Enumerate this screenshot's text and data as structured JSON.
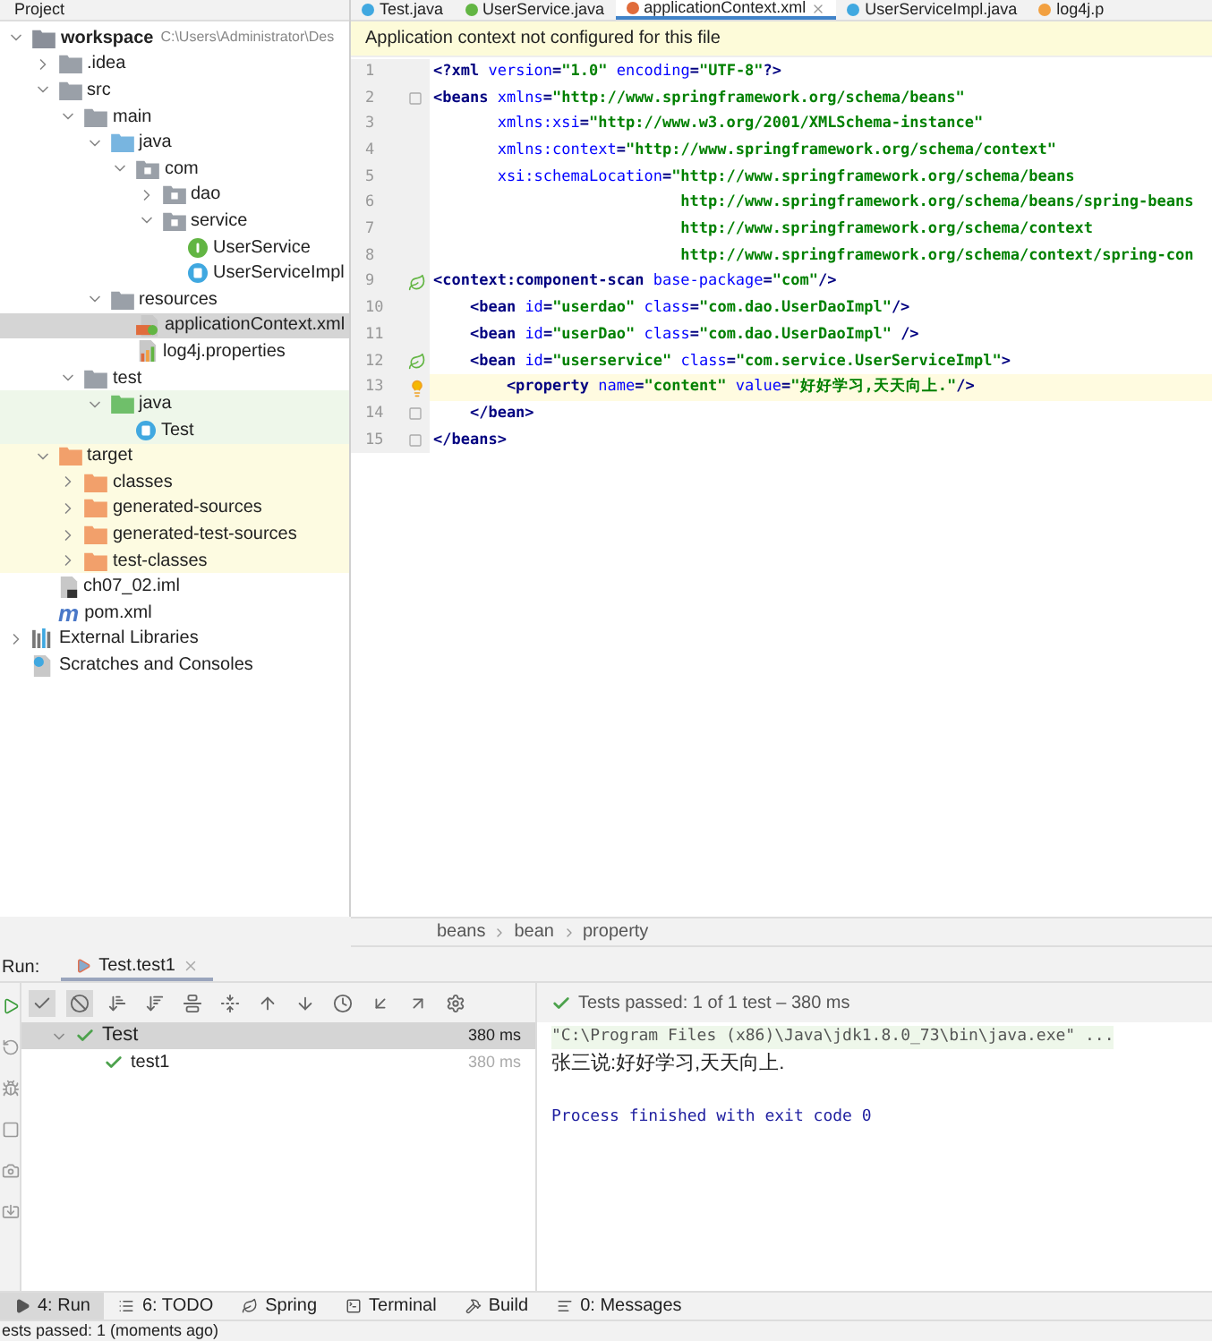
{
  "project_panel": {
    "title": "Project",
    "tree": [
      {
        "label": "workspace",
        "path": "C:\\Users\\Administrator\\Des",
        "kind": "module",
        "expanded": true,
        "selected": false,
        "children": [
          {
            "label": ".idea",
            "kind": "folder",
            "expanded": false,
            "selected": false
          },
          {
            "label": "src",
            "kind": "folder",
            "expanded": true,
            "selected": false,
            "children": [
              {
                "label": "main",
                "kind": "folder",
                "expanded": true,
                "selected": false,
                "children": [
                  {
                    "label": "java",
                    "kind": "source-folder",
                    "expanded": true,
                    "selected": false,
                    "children": [
                      {
                        "label": "com",
                        "kind": "package",
                        "expanded": true,
                        "selected": false,
                        "children": [
                          {
                            "label": "dao",
                            "kind": "package",
                            "expanded": false,
                            "selected": false
                          },
                          {
                            "label": "service",
                            "kind": "package",
                            "expanded": true,
                            "selected": false,
                            "children": [
                              {
                                "label": "UserService",
                                "kind": "interface",
                                "selected": false
                              },
                              {
                                "label": "UserServiceImpl",
                                "kind": "class",
                                "selected": false
                              }
                            ]
                          }
                        ]
                      }
                    ]
                  },
                  {
                    "label": "resources",
                    "kind": "resources",
                    "expanded": true,
                    "selected": false,
                    "children": [
                      {
                        "label": "applicationContext.xml",
                        "kind": "xml",
                        "selected": true
                      },
                      {
                        "label": "log4j.properties",
                        "kind": "properties",
                        "selected": false
                      }
                    ]
                  }
                ]
              },
              {
                "label": "test",
                "kind": "folder",
                "expanded": true,
                "selected": false,
                "children": [
                  {
                    "label": "java",
                    "kind": "test-folder",
                    "expanded": true,
                    "selected": false,
                    "children": [
                      {
                        "label": "Test",
                        "kind": "test-class",
                        "selected": false
                      }
                    ]
                  }
                ]
              }
            ]
          },
          {
            "label": "target",
            "kind": "excluded-folder",
            "expanded": true,
            "selected": false,
            "children": [
              {
                "label": "classes",
                "kind": "excluded-folder",
                "expanded": false,
                "selected": false
              },
              {
                "label": "generated-sources",
                "kind": "excluded-folder",
                "expanded": false,
                "selected": false
              },
              {
                "label": "generated-test-sources",
                "kind": "excluded-folder",
                "expanded": false,
                "selected": false
              },
              {
                "label": "test-classes",
                "kind": "excluded-folder",
                "expanded": false,
                "selected": false
              }
            ]
          },
          {
            "label": "ch07_02.iml",
            "kind": "iml",
            "selected": false
          },
          {
            "label": "pom.xml",
            "kind": "maven",
            "glyph": "m",
            "selected": false
          }
        ]
      },
      {
        "label": "External Libraries",
        "kind": "libraries",
        "expanded": false,
        "selected": false
      },
      {
        "label": "Scratches and Consoles",
        "kind": "scratches",
        "selected": false
      }
    ]
  },
  "editor": {
    "tabs": [
      {
        "label": "Test.java",
        "kind": "class",
        "selected": false
      },
      {
        "label": "UserService.java",
        "kind": "interface",
        "selected": false
      },
      {
        "label": "applicationContext.xml",
        "kind": "xml",
        "selected": true
      },
      {
        "label": "UserServiceImpl.java",
        "kind": "class",
        "selected": false
      },
      {
        "label": "log4j.p",
        "kind": "properties",
        "selected": false
      }
    ],
    "notification": "Application context not configured for this file",
    "lines": [
      {
        "number": "1",
        "current": false,
        "kind": "plain",
        "segments": [
          {
            "kind": "tag",
            "text": "<?xml "
          },
          {
            "kind": "attr",
            "text": "version"
          },
          {
            "kind": "tag",
            "text": "="
          },
          {
            "kind": "value",
            "text": "\"1.0\" "
          },
          {
            "kind": "attr",
            "text": "encoding"
          },
          {
            "kind": "tag",
            "text": "="
          },
          {
            "kind": "value",
            "text": "\"UTF-8\""
          },
          {
            "kind": "tag",
            "text": "?>"
          }
        ]
      },
      {
        "number": "2",
        "current": false,
        "kind": "fold",
        "segments": [
          {
            "kind": "tag",
            "text": "<beans "
          },
          {
            "kind": "attr",
            "text": "xmlns"
          },
          {
            "kind": "tag",
            "text": "="
          },
          {
            "kind": "value",
            "text": "\"http://www.springframework.org/schema/beans\""
          }
        ]
      },
      {
        "number": "3",
        "current": false,
        "kind": "plain",
        "segments": [
          {
            "kind": "attr",
            "text": "       xmlns:xsi"
          },
          {
            "kind": "tag",
            "text": "="
          },
          {
            "kind": "value",
            "text": "\"http://www.w3.org/2001/XMLSchema-instance\""
          }
        ]
      },
      {
        "number": "4",
        "current": false,
        "kind": "plain",
        "segments": [
          {
            "kind": "attr",
            "text": "       xmlns:context"
          },
          {
            "kind": "tag",
            "text": "="
          },
          {
            "kind": "value",
            "text": "\"http://www.springframework.org/schema/context\""
          }
        ]
      },
      {
        "number": "5",
        "current": false,
        "kind": "plain",
        "segments": [
          {
            "kind": "attr",
            "text": "       xsi:schemaLocation"
          },
          {
            "kind": "tag",
            "text": "="
          },
          {
            "kind": "value",
            "text": "\"http://www.springframework.org/schema/beans"
          }
        ]
      },
      {
        "number": "6",
        "current": false,
        "kind": "plain",
        "segments": [
          {
            "kind": "value",
            "text": "                           http://www.springframework.org/schema/beans/spring-beans"
          }
        ]
      },
      {
        "number": "7",
        "current": false,
        "kind": "plain",
        "segments": [
          {
            "kind": "value",
            "text": "                           http://www.springframework.org/schema/context"
          }
        ]
      },
      {
        "number": "8",
        "current": false,
        "kind": "plain",
        "segments": [
          {
            "kind": "value",
            "text": "                           http://www.springframework.org/schema/context/spring-con"
          }
        ]
      },
      {
        "number": "9",
        "current": false,
        "kind": "bean",
        "segments": [
          {
            "kind": "tag",
            "text": "<context:component-scan "
          },
          {
            "kind": "attr",
            "text": "base-package"
          },
          {
            "kind": "tag",
            "text": "="
          },
          {
            "kind": "value",
            "text": "\"com\""
          },
          {
            "kind": "tag",
            "text": "/>"
          }
        ]
      },
      {
        "number": "10",
        "current": false,
        "kind": "plain",
        "segments": [
          {
            "kind": "tag",
            "text": "    <bean "
          },
          {
            "kind": "attr",
            "text": "id"
          },
          {
            "kind": "tag",
            "text": "="
          },
          {
            "kind": "value",
            "text": "\"userdao\" "
          },
          {
            "kind": "attr",
            "text": "class"
          },
          {
            "kind": "tag",
            "text": "="
          },
          {
            "kind": "value",
            "text": "\"com.dao.UserDaoImpl\""
          },
          {
            "kind": "tag",
            "text": "/>"
          }
        ]
      },
      {
        "number": "11",
        "current": false,
        "kind": "plain",
        "segments": [
          {
            "kind": "tag",
            "text": "    <bean "
          },
          {
            "kind": "attr",
            "text": "id"
          },
          {
            "kind": "tag",
            "text": "="
          },
          {
            "kind": "value",
            "text": "\"userDao\" "
          },
          {
            "kind": "attr",
            "text": "class"
          },
          {
            "kind": "tag",
            "text": "="
          },
          {
            "kind": "value",
            "text": "\"com.dao.UserDaoImpl\" "
          },
          {
            "kind": "tag",
            "text": "/>"
          }
        ]
      },
      {
        "number": "12",
        "current": false,
        "kind": "bean",
        "segments": [
          {
            "kind": "tag",
            "text": "    <bean "
          },
          {
            "kind": "attr",
            "text": "id"
          },
          {
            "kind": "tag",
            "text": "="
          },
          {
            "kind": "value",
            "text": "\"userservice\" "
          },
          {
            "kind": "attr",
            "text": "class"
          },
          {
            "kind": "tag",
            "text": "="
          },
          {
            "kind": "value",
            "text": "\"com.service.UserServiceImpl\""
          },
          {
            "kind": "tag",
            "text": ">"
          }
        ]
      },
      {
        "number": "13",
        "current": true,
        "kind": "bulb",
        "segments": [
          {
            "kind": "tag",
            "text": "        <property "
          },
          {
            "kind": "attr",
            "text": "name"
          },
          {
            "kind": "tag",
            "text": "="
          },
          {
            "kind": "value",
            "text": "\"content\" "
          },
          {
            "kind": "attr",
            "text": "value"
          },
          {
            "kind": "tag",
            "text": "="
          },
          {
            "kind": "value",
            "text": "\"好好学习,天天向上.\""
          },
          {
            "kind": "tag",
            "text": "/>"
          }
        ]
      },
      {
        "number": "14",
        "current": false,
        "kind": "fold",
        "segments": [
          {
            "kind": "tag",
            "text": "    </bean>"
          }
        ]
      },
      {
        "number": "15",
        "current": false,
        "kind": "fold",
        "segments": [
          {
            "kind": "tag",
            "text": "</beans>"
          }
        ]
      }
    ],
    "breadcrumbs": [
      "beans",
      "bean",
      "property"
    ]
  },
  "run_panel": {
    "label": "Run:",
    "tab": "Test.test1",
    "summary": "Tests passed: 1 of 1 test – 380 ms",
    "tests": [
      {
        "name": "Test",
        "time": "380 ms",
        "passed": true,
        "selected": true,
        "children": [
          {
            "name": "test1",
            "time": "380 ms",
            "passed": true,
            "selected": false
          }
        ]
      }
    ],
    "console": [
      {
        "kind": "command",
        "text": "\"C:\\Program Files (x86)\\Java\\jdk1.8.0_73\\bin\\java.exe\" ..."
      },
      {
        "kind": "output",
        "text": "张三说:好好学习,天天向上."
      },
      {
        "kind": "system",
        "text": "Process finished with exit code 0"
      }
    ]
  },
  "tool_tabs": [
    {
      "label": "4: Run",
      "kind": "run",
      "selected": true
    },
    {
      "label": "6: TODO",
      "kind": "todo",
      "selected": false
    },
    {
      "label": "Spring",
      "kind": "spring",
      "selected": false
    },
    {
      "label": "Terminal",
      "kind": "terminal",
      "selected": false
    },
    {
      "label": "Build",
      "kind": "build",
      "selected": false
    },
    {
      "label": "0: Messages",
      "kind": "messages",
      "selected": false
    }
  ],
  "status_bar": "ests passed: 1 (moments ago)"
}
